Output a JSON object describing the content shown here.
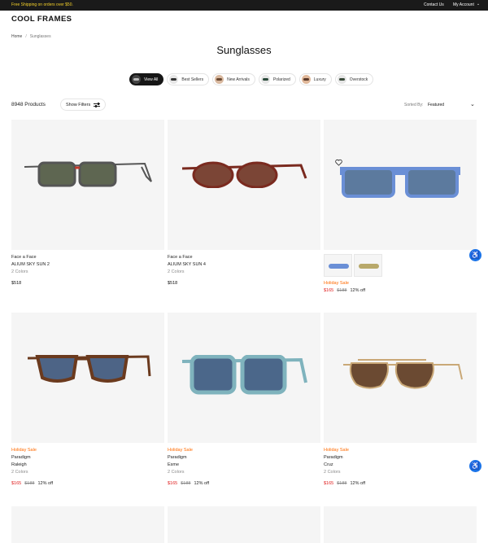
{
  "topbar": {
    "promo": "Free Shipping on orders over $50.",
    "contact": "Contact Us",
    "account": "My Account"
  },
  "brand": {
    "logo": "COOL FRAMES"
  },
  "breadcrumb": {
    "home": "Home",
    "separator": "/",
    "current": "Sunglasses"
  },
  "page": {
    "title": "Sunglasses"
  },
  "chips": [
    {
      "label": "View All",
      "active": true
    },
    {
      "label": "Best Sellers"
    },
    {
      "label": "New Arrivals"
    },
    {
      "label": "Polarized"
    },
    {
      "label": "Luxury"
    },
    {
      "label": "Overstock"
    }
  ],
  "toolbar": {
    "count": "8948 Products",
    "filters": "Show Filters",
    "sort_label": "Sorted By:",
    "sort_value": "Featured"
  },
  "products": [
    {
      "brand": "Face a Face",
      "model": "ALIUM SKY SUN 2",
      "colors": "2 Colors",
      "price": "$518",
      "frame": "#555555",
      "lens": "#5e6651"
    },
    {
      "brand": "Face a Face",
      "model": "ALIUM SKY SUN 4",
      "colors": "2 Colors",
      "price": "$518",
      "frame": "#7a2a1f",
      "lens": "#7b4536"
    },
    {
      "sale": "Holiday Sale",
      "price": "$165",
      "was": "$188",
      "off": "12% off",
      "frame": "#6a8fd6",
      "lens": "#5c7a9e"
    },
    {
      "sale": "Holiday Sale",
      "brand": "Paradigm",
      "model": "Raleigh",
      "colors": "2 Colors",
      "price": "$165",
      "was": "$188",
      "off": "12% off",
      "frame": "#6b3a1e",
      "lens": "#4d6486"
    },
    {
      "sale": "Holiday Sale",
      "brand": "Paradigm",
      "model": "Esme",
      "colors": "2 Colors",
      "price": "$165",
      "was": "$188",
      "off": "12% off",
      "frame": "#7fb3bd",
      "lens": "#4b678a"
    },
    {
      "sale": "Holiday Sale",
      "brand": "Paradigm",
      "model": "Cruz",
      "colors": "2 Colors",
      "price": "$165",
      "was": "$188",
      "off": "12% off",
      "frame": "#c9a877",
      "lens": "#6b4a32"
    }
  ],
  "swatches": [
    {
      "color": "#6a8fd6"
    },
    {
      "color": "#b8a86a"
    }
  ],
  "colors": {
    "sale": "#ff6a00",
    "price_now": "#e02020",
    "accessibility": "#1a73e8"
  }
}
